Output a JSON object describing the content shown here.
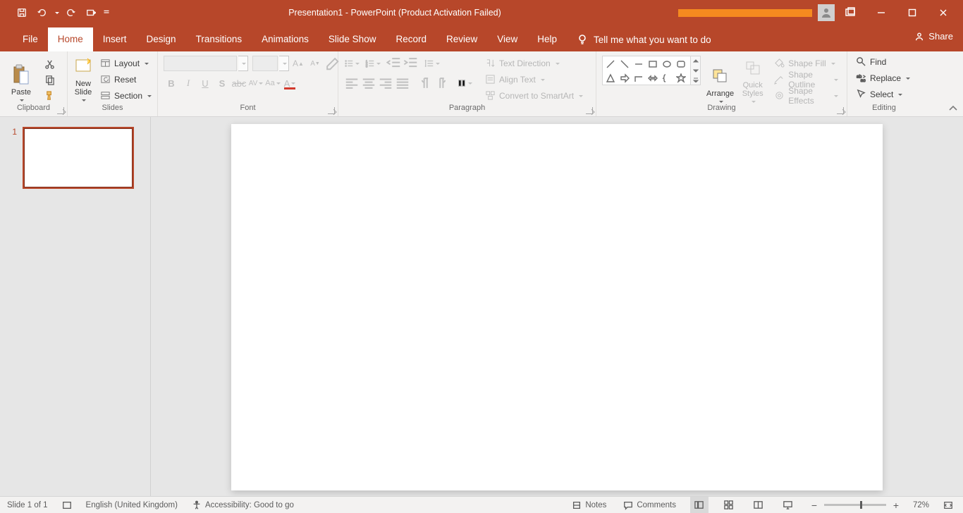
{
  "title": "Presentation1  -  PowerPoint (Product Activation Failed)",
  "tabs": {
    "file": "File",
    "home": "Home",
    "insert": "Insert",
    "design": "Design",
    "transitions": "Transitions",
    "animations": "Animations",
    "slideshow": "Slide Show",
    "record": "Record",
    "review": "Review",
    "view": "View",
    "help": "Help"
  },
  "tellme": "Tell me what you want to do",
  "share": "Share",
  "groups": {
    "clipboard": "Clipboard",
    "slides": "Slides",
    "font": "Font",
    "paragraph": "Paragraph",
    "drawing": "Drawing",
    "editing": "Editing"
  },
  "clipboard": {
    "paste": "Paste"
  },
  "slides": {
    "newslide": "New\nSlide",
    "layout": "Layout",
    "reset": "Reset",
    "section": "Section"
  },
  "font": {
    "name": "",
    "size": ""
  },
  "paragraph": {
    "textdir": "Text Direction",
    "align": "Align Text",
    "smartart": "Convert to SmartArt"
  },
  "drawing": {
    "arrange": "Arrange",
    "quick": "Quick\nStyles",
    "fill": "Shape Fill",
    "outline": "Shape Outline",
    "effects": "Shape Effects"
  },
  "editing": {
    "find": "Find",
    "replace": "Replace",
    "select": "Select"
  },
  "thumb": {
    "n1": "1"
  },
  "status": {
    "slide": "Slide 1 of 1",
    "lang": "English (United Kingdom)",
    "access": "Accessibility: Good to go",
    "notes": "Notes",
    "comments": "Comments",
    "zoom": "72%"
  }
}
